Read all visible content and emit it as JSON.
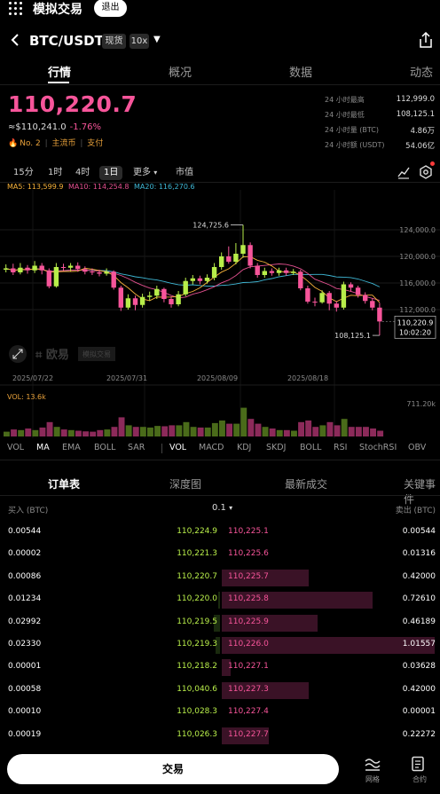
{
  "topbar": {
    "title": "模拟交易",
    "exit_label": "退出"
  },
  "header": {
    "pair": "BTC/USDT",
    "market_tag": "现货",
    "leverage_tag": "10x"
  },
  "main_tabs": [
    "行情",
    "概况",
    "数据",
    "动态"
  ],
  "price": {
    "last": "110,220.7",
    "fiat": "≈$110,241.0",
    "change_pct": "-1.76%",
    "rank": "No. 2",
    "tag1": "主流币",
    "tag2": "支付"
  },
  "stats": [
    {
      "label": "24 小时最高",
      "value": "112,999.0"
    },
    {
      "label": "24 小时最低",
      "value": "108,125.1"
    },
    {
      "label": "24 小时量 (BTC)",
      "value": "4.86万"
    },
    {
      "label": "24 小时额 (USDT)",
      "value": "54.06亿"
    }
  ],
  "intervals": [
    "15分",
    "1时",
    "4时",
    "1日",
    "更多",
    "市值"
  ],
  "active_interval": "1日",
  "ma_legend": {
    "ma5": "MA5: 113,599.9",
    "ma10": "MA10: 114,254.8",
    "ma20": "MA20: 116,270.6"
  },
  "colors": {
    "up": "#b8ee4a",
    "down": "#f7559a",
    "ma5": "#f7b23a",
    "ma10": "#e2508f",
    "ma20": "#3fb8d6"
  },
  "chart_data": {
    "type": "candlestick",
    "price_axis": [
      "124,000.0",
      "120,000.0",
      "116,000.0",
      "112,000.0"
    ],
    "date_axis": [
      "2025/07/22",
      "2025/07/31",
      "2025/08/09",
      "2025/08/18"
    ],
    "ylim": [
      106000,
      128000
    ],
    "high_label": "124,725.6",
    "low_label": "108,125.1",
    "current_label": "110,220.9",
    "current_time": "10:02:20",
    "watermark": "欧易",
    "watermark_tag": "模拟交易",
    "candles": [
      {
        "o": 118000,
        "c": 118200,
        "h": 118800,
        "l": 117600
      },
      {
        "o": 118200,
        "c": 117600,
        "h": 118900,
        "l": 117200
      },
      {
        "o": 117600,
        "c": 118300,
        "h": 119000,
        "l": 117300
      },
      {
        "o": 118300,
        "c": 117900,
        "h": 118700,
        "l": 117400
      },
      {
        "o": 117900,
        "c": 118600,
        "h": 119300,
        "l": 117500
      },
      {
        "o": 118600,
        "c": 117900,
        "h": 119000,
        "l": 117300
      },
      {
        "o": 117900,
        "c": 115500,
        "h": 118200,
        "l": 115200
      },
      {
        "o": 115500,
        "c": 118400,
        "h": 119000,
        "l": 115300
      },
      {
        "o": 118400,
        "c": 118300,
        "h": 118900,
        "l": 117800
      },
      {
        "o": 118300,
        "c": 118600,
        "h": 119000,
        "l": 117800
      },
      {
        "o": 118600,
        "c": 118100,
        "h": 119100,
        "l": 117700
      },
      {
        "o": 118100,
        "c": 117700,
        "h": 118500,
        "l": 117300
      },
      {
        "o": 117700,
        "c": 117600,
        "h": 118200,
        "l": 117200
      },
      {
        "o": 117600,
        "c": 117400,
        "h": 118000,
        "l": 117000
      },
      {
        "o": 117400,
        "c": 117700,
        "h": 118200,
        "l": 117100
      },
      {
        "o": 117700,
        "c": 115300,
        "h": 117900,
        "l": 115000
      },
      {
        "o": 115300,
        "c": 112300,
        "h": 115600,
        "l": 111800
      },
      {
        "o": 112300,
        "c": 113700,
        "h": 114300,
        "l": 112000
      },
      {
        "o": 113700,
        "c": 112700,
        "h": 114100,
        "l": 111900
      },
      {
        "o": 112700,
        "c": 113900,
        "h": 114400,
        "l": 112300
      },
      {
        "o": 113900,
        "c": 114100,
        "h": 114700,
        "l": 113300
      },
      {
        "o": 114100,
        "c": 115100,
        "h": 115600,
        "l": 113600
      },
      {
        "o": 115100,
        "c": 113600,
        "h": 115300,
        "l": 113100
      },
      {
        "o": 113600,
        "c": 112800,
        "h": 114000,
        "l": 112300
      },
      {
        "o": 112800,
        "c": 114300,
        "h": 114800,
        "l": 112500
      },
      {
        "o": 114300,
        "c": 116300,
        "h": 116800,
        "l": 114000
      },
      {
        "o": 116300,
        "c": 116700,
        "h": 117200,
        "l": 115800
      },
      {
        "o": 116700,
        "c": 116300,
        "h": 117100,
        "l": 115800
      },
      {
        "o": 116300,
        "c": 116800,
        "h": 117300,
        "l": 115900
      },
      {
        "o": 116800,
        "c": 118400,
        "h": 119000,
        "l": 116400
      },
      {
        "o": 118400,
        "c": 120000,
        "h": 120600,
        "l": 118000
      },
      {
        "o": 120000,
        "c": 119200,
        "h": 121500,
        "l": 118900
      },
      {
        "o": 119200,
        "c": 120400,
        "h": 122000,
        "l": 118800
      },
      {
        "o": 120400,
        "c": 121700,
        "h": 124725.6,
        "l": 119800
      },
      {
        "o": 121700,
        "c": 118600,
        "h": 122100,
        "l": 118200
      },
      {
        "o": 118600,
        "c": 117200,
        "h": 119000,
        "l": 116800
      },
      {
        "o": 117200,
        "c": 117800,
        "h": 118300,
        "l": 116800
      },
      {
        "o": 117800,
        "c": 117500,
        "h": 118200,
        "l": 117100
      },
      {
        "o": 117500,
        "c": 117900,
        "h": 118300,
        "l": 117100
      },
      {
        "o": 117900,
        "c": 117500,
        "h": 118300,
        "l": 117100
      },
      {
        "o": 117500,
        "c": 117700,
        "h": 118100,
        "l": 117200
      },
      {
        "o": 117700,
        "c": 115200,
        "h": 118000,
        "l": 114900
      },
      {
        "o": 115200,
        "c": 113200,
        "h": 115600,
        "l": 112900
      },
      {
        "o": 113200,
        "c": 113100,
        "h": 113800,
        "l": 112500
      },
      {
        "o": 113100,
        "c": 114500,
        "h": 114900,
        "l": 112900
      },
      {
        "o": 114500,
        "c": 112900,
        "h": 114800,
        "l": 111900
      },
      {
        "o": 112900,
        "c": 112300,
        "h": 113300,
        "l": 111700
      },
      {
        "o": 112300,
        "c": 115800,
        "h": 116200,
        "l": 112000
      },
      {
        "o": 115800,
        "c": 115300,
        "h": 116100,
        "l": 114700
      },
      {
        "o": 115300,
        "c": 114200,
        "h": 115600,
        "l": 113800
      },
      {
        "o": 114200,
        "c": 113300,
        "h": 114600,
        "l": 112900
      },
      {
        "o": 113300,
        "c": 112300,
        "h": 113700,
        "l": 111900
      },
      {
        "o": 112300,
        "c": 110220.7,
        "h": 112999,
        "l": 108125.1
      }
    ],
    "vol_label": "VOL: 13.6k",
    "vol_axis_label": "711.20k",
    "volumes": [
      0.15,
      0.22,
      0.2,
      0.25,
      0.2,
      0.28,
      0.45,
      0.3,
      0.22,
      0.2,
      0.18,
      0.16,
      0.15,
      0.2,
      0.22,
      0.3,
      0.6,
      0.35,
      0.3,
      0.3,
      0.28,
      0.33,
      0.32,
      0.35,
      0.35,
      0.45,
      0.3,
      0.28,
      0.28,
      0.42,
      0.5,
      0.4,
      0.4,
      0.9,
      0.55,
      0.4,
      0.3,
      0.25,
      0.2,
      0.2,
      0.18,
      0.45,
      0.5,
      0.3,
      0.35,
      0.45,
      0.35,
      0.55,
      0.3,
      0.3,
      0.3,
      0.25,
      0.18
    ]
  },
  "indicator_tabs": [
    "VOL",
    "MA",
    "EMA",
    "BOLL",
    "SAR",
    "VOL",
    "MACD",
    "KDJ",
    "SKDJ",
    "BOLL",
    "RSI",
    "StochRSI",
    "OBV"
  ],
  "section_tabs": [
    "订单表",
    "深度图",
    "最新成交",
    "关键事件"
  ],
  "orderbook": {
    "bid_header": "买入 (BTC)",
    "ask_header": "卖出 (BTC)",
    "precision": "0.1",
    "rows": [
      {
        "bid_amt": "0.00544",
        "bid_px": "110,224.9",
        "ask_px": "110,225.1",
        "ask_amt": "0.00544",
        "bid_depth": 0.0,
        "ask_depth": 0.0
      },
      {
        "bid_amt": "0.00002",
        "bid_px": "110,221.3",
        "ask_px": "110,225.6",
        "ask_amt": "0.01316",
        "bid_depth": 0.0,
        "ask_depth": 0.0
      },
      {
        "bid_amt": "0.00086",
        "bid_px": "110,220.7",
        "ask_px": "110,225.7",
        "ask_amt": "0.42000",
        "bid_depth": 0.0,
        "ask_depth": 0.41
      },
      {
        "bid_amt": "0.01234",
        "bid_px": "110,220.0",
        "ask_px": "110,225.8",
        "ask_amt": "0.72610",
        "bid_depth": 0.01,
        "ask_depth": 0.71
      },
      {
        "bid_amt": "0.02992",
        "bid_px": "110,219.5",
        "ask_px": "110,225.9",
        "ask_amt": "0.46189",
        "bid_depth": 0.03,
        "ask_depth": 0.45
      },
      {
        "bid_amt": "0.02330",
        "bid_px": "110,219.3",
        "ask_px": "110,226.0",
        "ask_amt": "1.01557",
        "bid_depth": 0.02,
        "ask_depth": 1.0
      },
      {
        "bid_amt": "0.00001",
        "bid_px": "110,218.2",
        "ask_px": "110,227.1",
        "ask_amt": "0.03628",
        "bid_depth": 0.0,
        "ask_depth": 0.04
      },
      {
        "bid_amt": "0.00058",
        "bid_px": "110,040.6",
        "ask_px": "110,227.3",
        "ask_amt": "0.42000",
        "bid_depth": 0.0,
        "ask_depth": 0.41
      },
      {
        "bid_amt": "0.00010",
        "bid_px": "110,028.3",
        "ask_px": "110,227.4",
        "ask_amt": "0.00001",
        "bid_depth": 0.0,
        "ask_depth": 0.0
      },
      {
        "bid_amt": "0.00019",
        "bid_px": "110,026.3",
        "ask_px": "110,227.7",
        "ask_amt": "0.22272",
        "bid_depth": 0.0,
        "ask_depth": 0.22
      }
    ]
  },
  "bottombar": {
    "trade_label": "交易",
    "grid_label": "网格",
    "contract_label": "合约"
  }
}
